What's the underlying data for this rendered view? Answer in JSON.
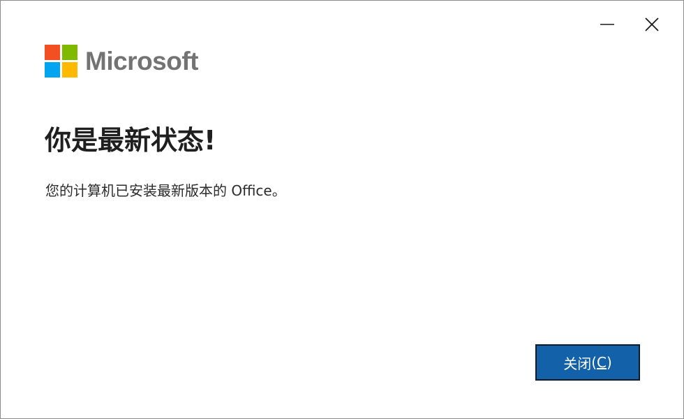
{
  "window": {
    "minimize_icon": "minimize-icon",
    "close_icon": "close-icon"
  },
  "logo": {
    "text": "Microsoft",
    "colors": [
      "#f25022",
      "#7fba00",
      "#00a4ef",
      "#ffb900"
    ]
  },
  "dialog": {
    "heading": "你是最新状态!",
    "message": "您的计算机已安装最新版本的 Office。"
  },
  "button": {
    "label": "关闭",
    "accelerator_open": "(",
    "accelerator_key": "C",
    "accelerator_close": ")",
    "color": "#1261a9"
  }
}
